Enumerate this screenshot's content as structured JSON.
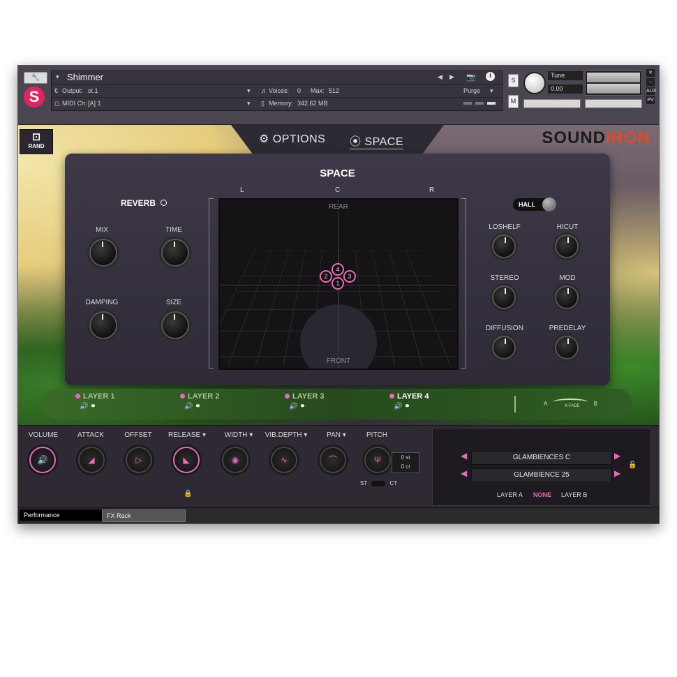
{
  "header": {
    "instrument_name": "Shimmer",
    "output_label": "Output:",
    "output_value": "st.1",
    "voices_label": "Voices:",
    "voices_value": "0",
    "max_label": "Max:",
    "max_value": "512",
    "purge_label": "Purge",
    "midi_label": "MIDI Ch:",
    "midi_value": "[A] 1",
    "memory_label": "Memory:",
    "memory_value": "342.62 MB",
    "tune_label": "Tune",
    "tune_value": "0.00",
    "s_label": "S",
    "m_label": "M",
    "aux_label": "AUX",
    "pv_label": "PV"
  },
  "nav": {
    "rand_label": "RAND",
    "tab_options": "OPTIONS",
    "tab_space": "SPACE",
    "active_tab": "SPACE",
    "brand_sound": "SOUND",
    "brand_iron": "IRON"
  },
  "space_panel": {
    "title": "SPACE",
    "reverb_label": "REVERB",
    "knobs_left": [
      "MIX",
      "TIME",
      "DAMPING",
      "SIZE"
    ],
    "stage_L": "L",
    "stage_C": "C",
    "stage_R": "R",
    "stage_rear": "REAR",
    "stage_front": "FRONT",
    "layer_dots": [
      "1",
      "2",
      "3",
      "4"
    ],
    "hall_label": "HALL",
    "knobs_right": [
      "LOSHELF",
      "HICUT",
      "STEREO",
      "MOD",
      "DIFFUSION",
      "PREDELAY"
    ]
  },
  "layers": {
    "items": [
      "LAYER 1",
      "LAYER 2",
      "LAYER 3",
      "LAYER 4"
    ],
    "active": "LAYER 4",
    "xfade_a": "A",
    "xfade_b": "B",
    "xfade_label": "X-FADE"
  },
  "bottom": {
    "volume": "VOLUME",
    "attack": "ATTACK",
    "offset": "OFFSET",
    "release": "RELEASE",
    "width": "WIDTH",
    "vibdepth": "VIB.DEPTH",
    "pan": "PAN",
    "pitch": "PITCH",
    "pitch_st_val": "0 st",
    "pitch_ct_val": "0 ct",
    "st_label": "ST",
    "ct_label": "CT",
    "patch_a": "GLAMBIENCES C",
    "patch_b": "GLAMBIENCE 25",
    "layer_a_label": "LAYER A",
    "none_label": "NONE",
    "layer_b_label": "LAYER B"
  },
  "footer": {
    "tab_performance": "Performance",
    "tab_fxrack": "FX Rack"
  },
  "colors": {
    "accent": "#e86ab8",
    "brand_iron": "#e04a2e",
    "panel_bg": "#2f2a36"
  }
}
